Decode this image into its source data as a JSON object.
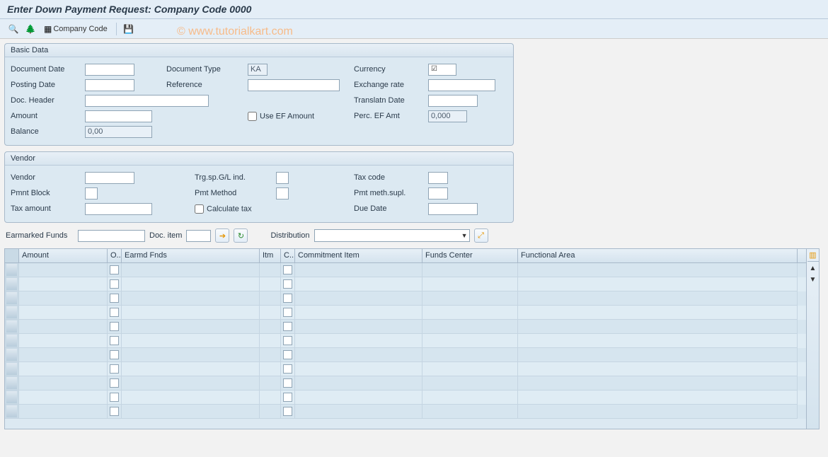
{
  "title": "Enter Down Payment Request: Company Code 0000",
  "watermark": "© www.tutorialkart.com",
  "toolbar": {
    "btn1_title": "Display",
    "btn2_title": "Tree",
    "company_code_label": "Company Code",
    "btn4_title": "Park"
  },
  "basic": {
    "title": "Basic Data",
    "document_date": "Document Date",
    "posting_date": "Posting Date",
    "doc_header": "Doc. Header",
    "amount": "Amount",
    "balance": "Balance",
    "balance_val": "0,00",
    "document_type": "Document Type",
    "document_type_val": "KA",
    "reference": "Reference",
    "use_ef_amount": "Use EF Amount",
    "currency": "Currency",
    "exchange_rate": "Exchange rate",
    "translatn_date": "Translatn Date",
    "perc_ef_amt": "Perc. EF Amt",
    "perc_ef_amt_val": "0,000"
  },
  "vendor": {
    "title": "Vendor",
    "vendor": "Vendor",
    "pmnt_block": "Pmnt Block",
    "tax_amount": "Tax amount",
    "trg_sp": "Trg.sp.G/L ind.",
    "pmt_method": "Pmt Method",
    "calc_tax": "Calculate tax",
    "tax_code": "Tax code",
    "pmt_supl": "Pmt meth.supl.",
    "due_date": "Due Date"
  },
  "ear": {
    "earmarked": "Earmarked Funds",
    "doc_item": "Doc. item",
    "distribution": "Distribution"
  },
  "table": {
    "cols": {
      "amount": "Amount",
      "o": "O..",
      "earmd": "Earmd Fnds",
      "itm": "Itm",
      "c": "C..",
      "ci": "Commitment Item",
      "fc": "Funds Center",
      "fa": "Functional Area"
    }
  }
}
